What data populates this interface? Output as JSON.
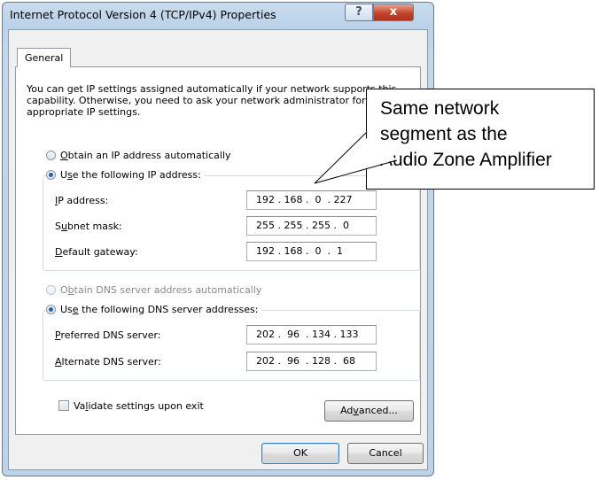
{
  "window": {
    "title": "Internet Protocol Version 4 (TCP/IPv4) Properties",
    "help_label": "?",
    "close_label": "x"
  },
  "tab": {
    "label": "General"
  },
  "intro": "You can get IP settings assigned automatically if your network supports this capability. Otherwise, you need to ask your network administrator for the appropriate IP settings.",
  "ip": {
    "auto_prefix": "",
    "auto_mnemonic": "O",
    "auto_rest": "btain an IP address automatically",
    "manual_prefix": "U",
    "manual_mnemonic": "s",
    "manual_rest": "e the following IP address:",
    "address_m": "I",
    "address_rest": "P address:",
    "address_value": "192 . 168 .  0  . 227",
    "subnet_pre": "S",
    "subnet_m": "u",
    "subnet_rest": "bnet mask:",
    "subnet_value": "255 . 255 . 255 .  0",
    "gateway_m": "D",
    "gateway_rest": "efault gateway:",
    "gateway_value": "192 . 168 .  0  .  1"
  },
  "dns": {
    "auto_pre": "O",
    "auto_m": "b",
    "auto_rest": "tain DNS server address automatically",
    "manual_pre": "Us",
    "manual_m": "e",
    "manual_rest": " the following DNS server addresses:",
    "preferred_m": "P",
    "preferred_rest": "referred DNS server:",
    "preferred_value": "202 .  96  . 134 . 133",
    "alternate_m": "A",
    "alternate_rest": "lternate DNS server:",
    "alternate_value": "202 .  96  . 128 .  68"
  },
  "validate": {
    "pre": "Va",
    "m": "l",
    "rest": "idate settings upon exit"
  },
  "buttons": {
    "advanced_pre": "Ad",
    "advanced_m": "v",
    "advanced_rest": "anced...",
    "ok": "OK",
    "cancel": "Cancel"
  },
  "callout": {
    "line1": "Same network",
    "line2": "segment as the",
    "line3": "Audio Zone Amplifier"
  }
}
